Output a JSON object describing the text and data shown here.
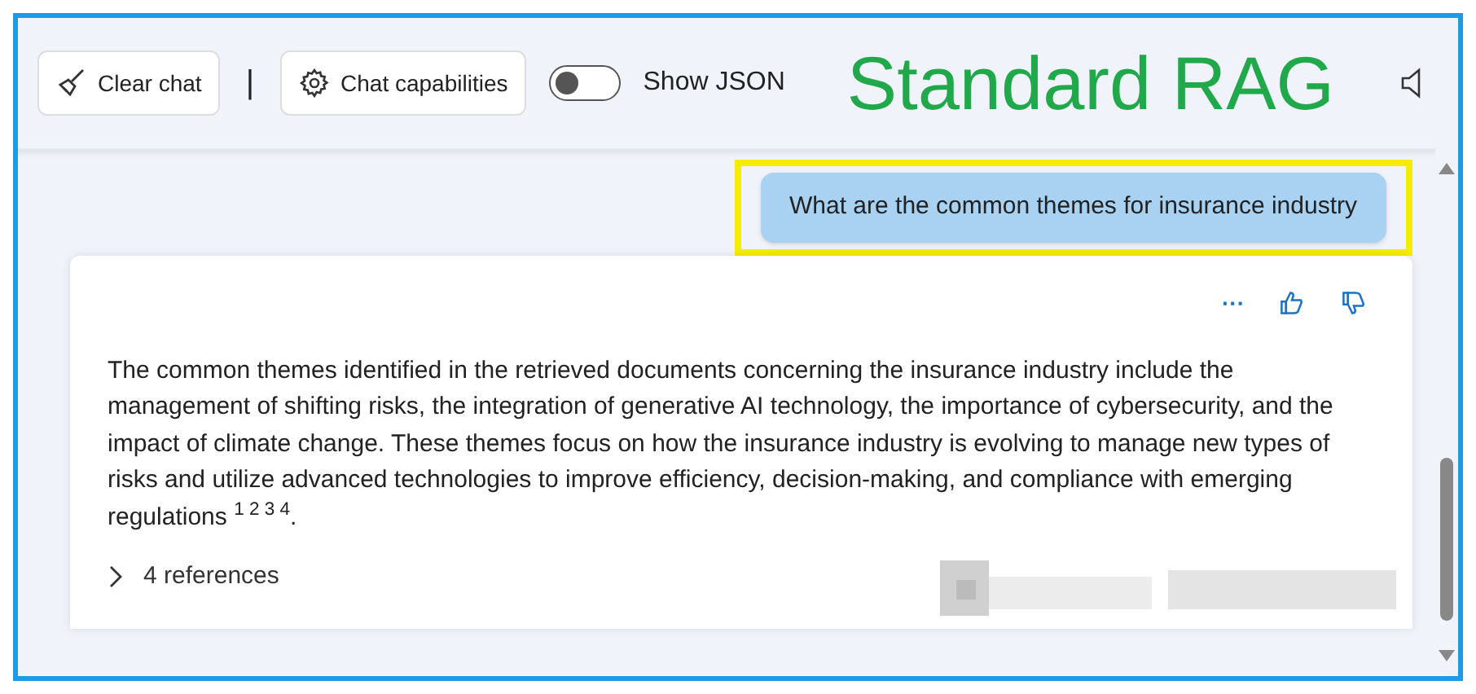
{
  "toolbar": {
    "clear_button": "Clear chat",
    "separator": "|",
    "capabilities_button": "Chat capabilities",
    "toggle": {
      "label": "Show JSON",
      "on": false
    }
  },
  "title": "Standard RAG",
  "messages": [
    {
      "kind": "user",
      "text": "What are the common themes for insurance industry",
      "highlighted": true
    },
    {
      "kind": "assistant",
      "more": "···",
      "text": "The common themes identified in the retrieved documents concerning the insurance industry include the management of shifting risks, the integration of generative AI technology, the importance of cybersecurity, and the impact of climate change. These themes focus on how the insurance industry is evolving to manage new types of risks and utilize advanced technologies to improve efficiency, decision-making, and compliance with emerging regulations $^{1 2 3 4}$.",
      "references": {
        "label": "4 references",
        "expanded": false
      }
    }
  ]
}
